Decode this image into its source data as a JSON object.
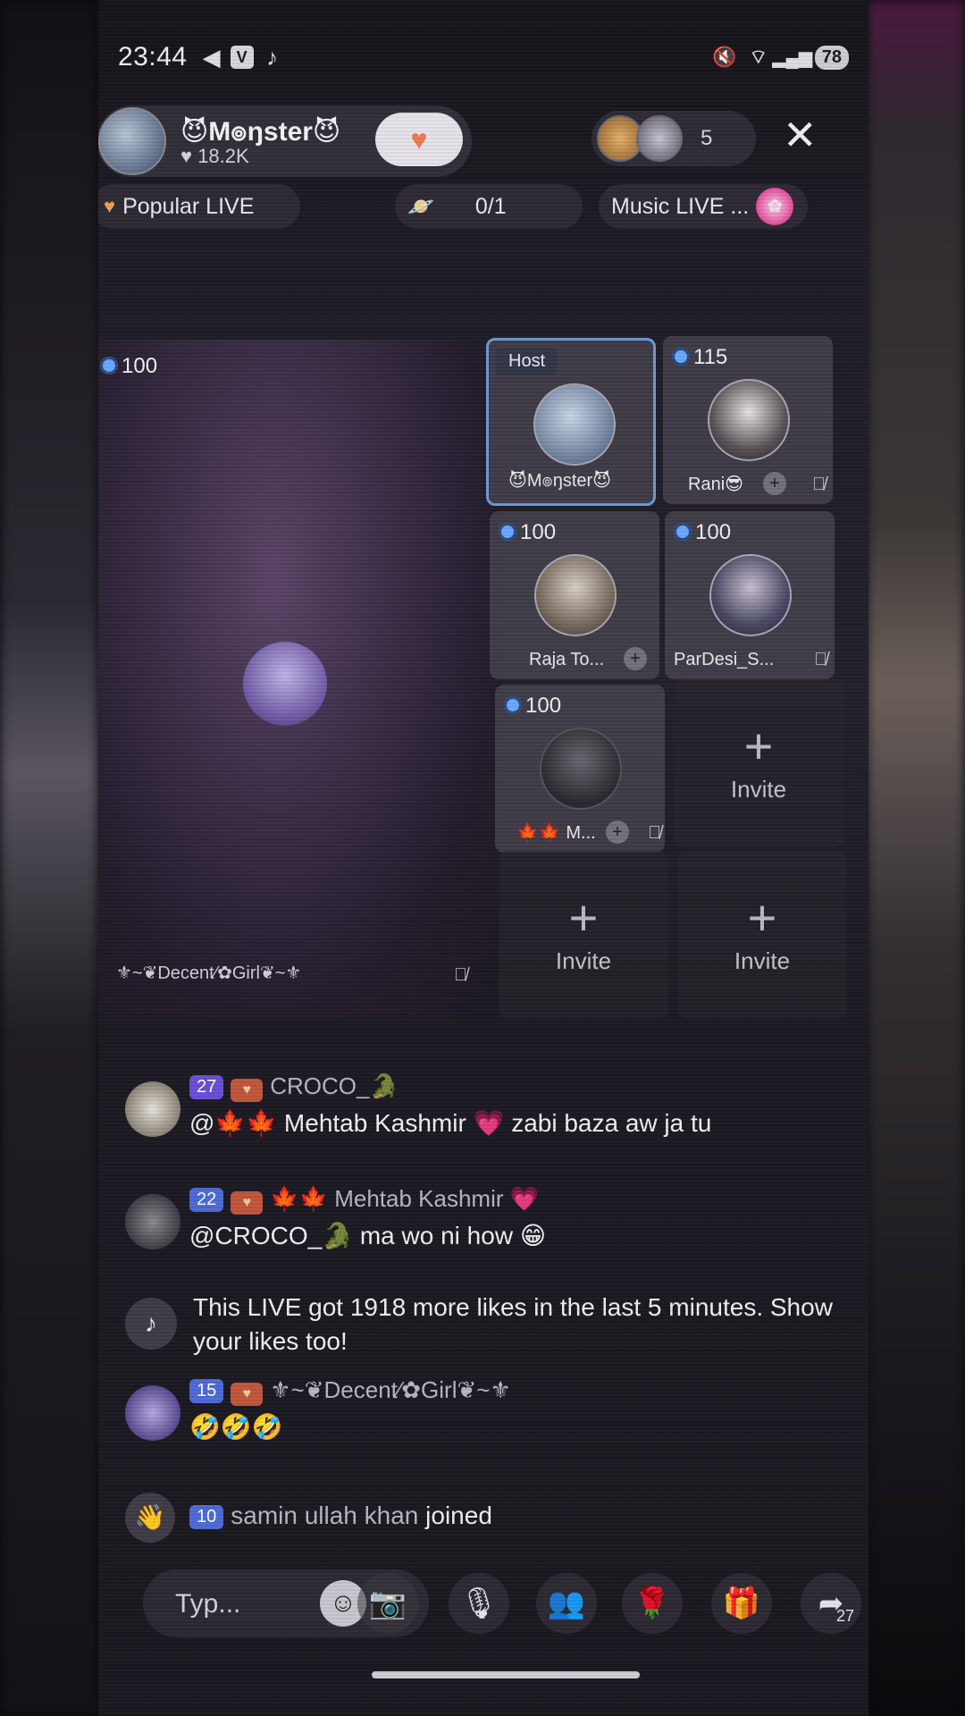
{
  "status_bar": {
    "time": "23:44",
    "battery": "78",
    "icons": [
      "telegram-icon",
      "v-app-icon",
      "tiktok-icon",
      "mute-icon",
      "wifi-icon",
      "signal-icon"
    ]
  },
  "host": {
    "name": "😈M๏ŋster😈",
    "likes": "18.2K",
    "viewer_count": "5"
  },
  "tags": {
    "popular": "Popular LIVE",
    "guests": "0/1",
    "music": "Music LIVE ..."
  },
  "main_guest": {
    "score": "100",
    "name": "⚜︎~❦Decent⁄✿Girl❦~⚜︎"
  },
  "tiles": [
    {
      "label": "Host",
      "name": "😈M๏ŋster😈"
    },
    {
      "score": "115",
      "name": "Rani😎"
    },
    {
      "score": "100",
      "name": "Raja To..."
    },
    {
      "score": "100",
      "name": "ParDesi_S..."
    },
    {
      "score": "100",
      "name": "🍁🍁 M..."
    }
  ],
  "invite_label": "Invite",
  "chat": [
    {
      "level": "27",
      "user": "CROCO_🐊",
      "text": "@🍁🍁 Mehtab Kashmir 💗 zabi baza aw ja tu"
    },
    {
      "level": "22",
      "user": "🍁🍁 Mehtab Kashmir 💗",
      "text": "@CROCO_🐊 ma wo ni how 😁"
    },
    {
      "text": "This LIVE got 1918 more likes in the last 5 minutes. Show your likes too!"
    },
    {
      "level": "15",
      "user": "⚜︎~❦Decent⁄✿Girl❦~⚜︎",
      "text": "🤣🤣🤣"
    }
  ],
  "join": {
    "level": "10",
    "user": "samin ullah khan",
    "action": "joined"
  },
  "bottom": {
    "placeholder": "Typ...",
    "share_count": "27"
  }
}
